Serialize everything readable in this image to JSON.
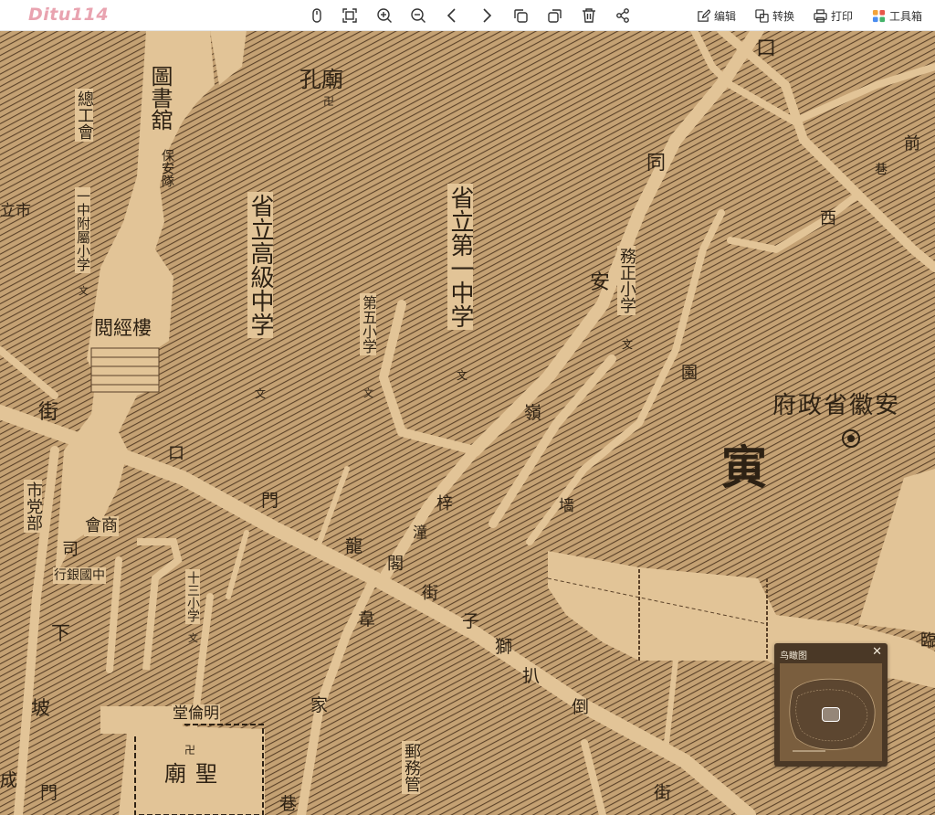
{
  "toolbar": {
    "logo": "Ditu114",
    "edit_label": "编辑",
    "convert_label": "转换",
    "print_label": "打印",
    "toolbox_label": "工具箱"
  },
  "overview": {
    "title": "鸟瞰图",
    "close": "✕"
  },
  "map_labels": {
    "library": "圖書舘",
    "confucius_temple": "孔廟",
    "temple_sym": "卍",
    "union": "總工會",
    "security_team": "保安隊",
    "city_left": "立市",
    "provincial_high_school": "省立高級中学",
    "wen1": "文",
    "first_middle_school": "省立第一中学",
    "wen2": "文",
    "fifth_primary": "第五小学",
    "wen3": "文",
    "affiliated_primary": "一中附屬小学",
    "wen4": "文",
    "yuejing_building": "閲經樓",
    "jie1": "街",
    "kou1": "口",
    "tong": "同",
    "an": "安",
    "wuzheng_primary": "務正小学",
    "wen5": "文",
    "yuan": "園",
    "provincial_gov": "安徽省政府",
    "xi": "西",
    "qian": "前",
    "xiang1": "巷",
    "city_party": "市党部",
    "shanghui": "商會",
    "company": "司",
    "bank": "中國銀行",
    "ling": "嶺",
    "men": "門",
    "long": "龍",
    "zhi": "梓",
    "tong2": "潼",
    "ge": "閣",
    "qiang": "墙",
    "jie2": "街",
    "thirteenth_primary": "十三小学",
    "wen6": "文",
    "wei": "韋",
    "zi": "子",
    "shi": "獅",
    "ba": "扒",
    "dao": "倒",
    "xia": "下",
    "po": "坡",
    "jia": "家",
    "minglun_hall": "明倫堂",
    "temple_sym2": "卍",
    "sheng": "聖",
    "miao": "廟",
    "post_office": "郵務管",
    "cheng": "成",
    "men2": "門",
    "xiang2": "巷",
    "jie3": "街",
    "kou_top": "口",
    "stamp": "寅",
    "lin": "臨"
  },
  "colors": {
    "paper": "#d9b98a",
    "hatch": "#5a4128",
    "road": "#e6cba0",
    "ink": "#2e2214"
  },
  "icons": [
    "mouse-icon",
    "fullscreen-icon",
    "zoom-in-icon",
    "zoom-out-icon",
    "prev-icon",
    "next-icon",
    "copy-icon",
    "paste-icon",
    "delete-icon",
    "share-icon",
    "edit-icon",
    "convert-icon",
    "print-icon",
    "toolbox-icon"
  ]
}
